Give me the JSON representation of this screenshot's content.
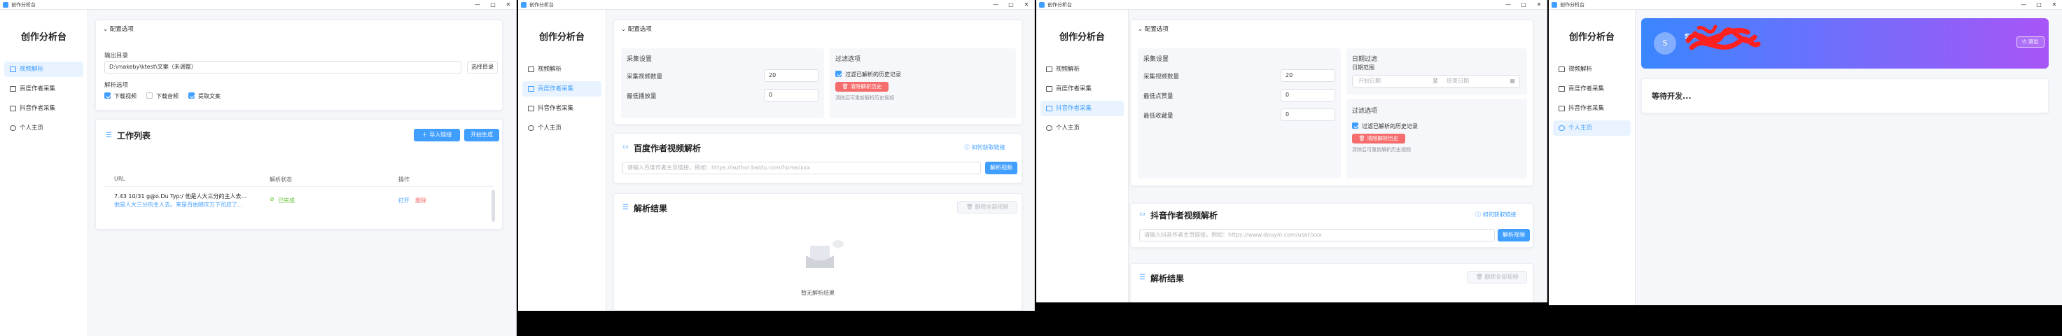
{
  "app": {
    "window_title": "创作分析台",
    "brand": "创作分析台",
    "controls": [
      "—",
      "□",
      "✕"
    ],
    "nav": [
      "视频解析",
      "百度作者采集",
      "抖音作者采集",
      "个人主页"
    ]
  },
  "config": {
    "header": "配置选项",
    "output_dir_label": "输出目录",
    "output_dir_value": "D:\\makeby\\ktest\\文案（未调整）",
    "choose_dir_button": "选择目录",
    "parse_options_label": "解析选项",
    "options": [
      {
        "label": "下载视频",
        "checked": true
      },
      {
        "label": "下载音频",
        "checked": false
      },
      {
        "label": "提取文案",
        "checked": true
      }
    ]
  },
  "worklist": {
    "title": "工作列表",
    "import_button": "导入链接",
    "start_button": "开始生成",
    "columns": [
      "URL",
      "解析状态",
      "操作"
    ],
    "rows": [
      {
        "url_line1": "7.43 10/31 g@o.Du Typ:/ 他是人大三分的主人去...",
        "url_line2": "他是人大三分的主人去。来是百由随庆万下司应了...",
        "status": "已完成",
        "open": "打开",
        "delete": "删除"
      }
    ]
  },
  "collect": {
    "settings_title": "采集设置",
    "max_videos_label": "采集视频数量",
    "max_videos_value": "20",
    "min_plays_label": "最低播放量",
    "min_plays_value": "0",
    "min_likes_label": "最低点赞量",
    "min_likes_value": "0",
    "min_comments_label": "最低收藏量",
    "min_comments_value": "0",
    "filter_title": "过滤选项",
    "filter_checkbox": "过滤已解析的历史记录",
    "clear_history_button": "清除解析历史",
    "clear_hint": "清除后可重新解析历史视频",
    "date_filter_title": "日期过滤",
    "date_range_label": "日期范围",
    "date_start_ph": "开始日期",
    "date_sep": "至",
    "date_end_ph": "结束日期"
  },
  "baidu": {
    "title": "百度作者视频解析",
    "help_link": "如何获取链接",
    "input_placeholder": "请输入百度作者主页链接，例如：https://author.baidu.com/home/xxx",
    "parse_button": "解析视频"
  },
  "douyin": {
    "title": "抖音作者视频解析",
    "help_link": "如何获取链接",
    "input_placeholder": "请输入抖音作者主页链接，例如：https://www.douyin.com/user/xxx",
    "parse_button": "解析视频"
  },
  "results": {
    "title": "解析结果",
    "delete_button": "删除全部视频",
    "empty_text": "暂无解析结果"
  },
  "profile": {
    "avatar_letter": "S",
    "username": "sm",
    "logout_button": "退出",
    "placeholder_text": "等待开发..."
  },
  "colors": {
    "accent": "#409eff",
    "danger": "#f56c6c",
    "profile_gradient_start": "#3a86ff",
    "profile_gradient_end": "#a855f7",
    "redaction": "#ff2020"
  }
}
